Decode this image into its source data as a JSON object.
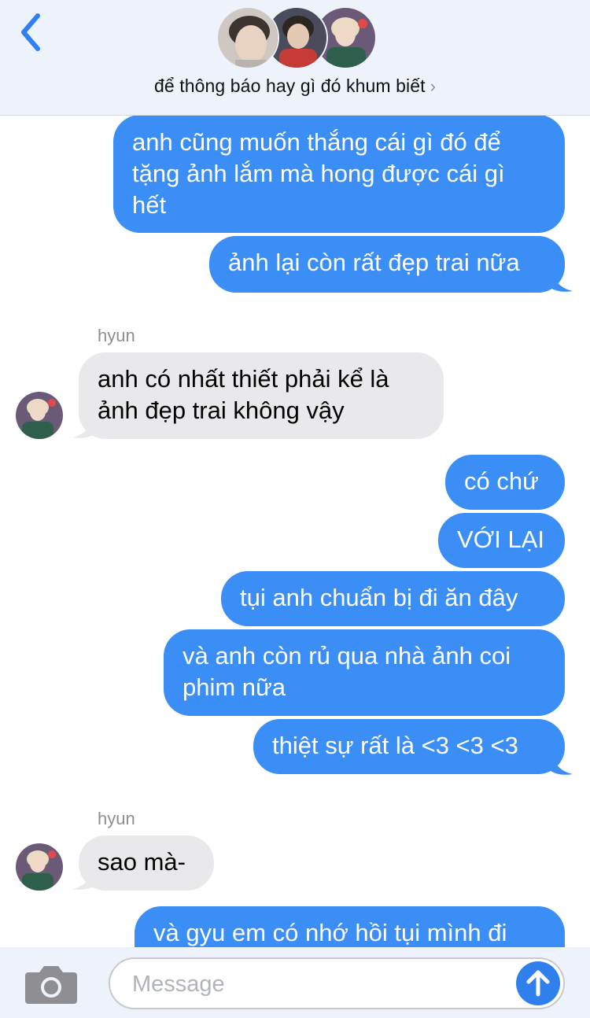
{
  "header": {
    "back_icon": "chevron-left-icon",
    "group_name": "để thông báo hay gì đó khum biết",
    "chevron": "›",
    "accent": "#2f7ff5"
  },
  "messages": [
    {
      "type": "outgoing",
      "lines": [
        "anh cũng muốn thắng cái gì đó để",
        "tặng ảnh lắm mà hong được cái gì",
        "hết"
      ]
    },
    {
      "type": "outgoing",
      "lines": [
        "ảnh lại còn rất đẹp trai nữa"
      ]
    },
    {
      "type": "sender",
      "text": "hyun"
    },
    {
      "type": "incoming",
      "lines": [
        "anh có nhất thiết phải kể là",
        "ảnh đẹp trai không vậy"
      ]
    },
    {
      "type": "outgoing",
      "lines": [
        "có chứ"
      ]
    },
    {
      "type": "outgoing",
      "lines": [
        "VỚI LẠI"
      ]
    },
    {
      "type": "outgoing",
      "lines": [
        "tụi anh chuẩn bị đi ăn đây"
      ]
    },
    {
      "type": "outgoing",
      "lines": [
        "và anh còn rủ qua nhà ảnh coi",
        "phim nữa"
      ]
    },
    {
      "type": "outgoing",
      "lines": [
        "thiệt sự rất là <3 <3 <3"
      ]
    },
    {
      "type": "sender",
      "text": "hyun"
    },
    {
      "type": "incoming",
      "lines": [
        "sao mà-"
      ]
    },
    {
      "type": "outgoing",
      "lines": [
        "và gyu em có nhớ hồi tụi mình đi"
      ]
    }
  ],
  "composer": {
    "camera_icon": "camera-icon",
    "placeholder": "Message",
    "send_icon": "arrow-up-icon"
  },
  "colors": {
    "outgoing_bubble": "#3a8ef5",
    "incoming_bubble": "#e9e9eb",
    "header_bg": "#eef3fb"
  }
}
